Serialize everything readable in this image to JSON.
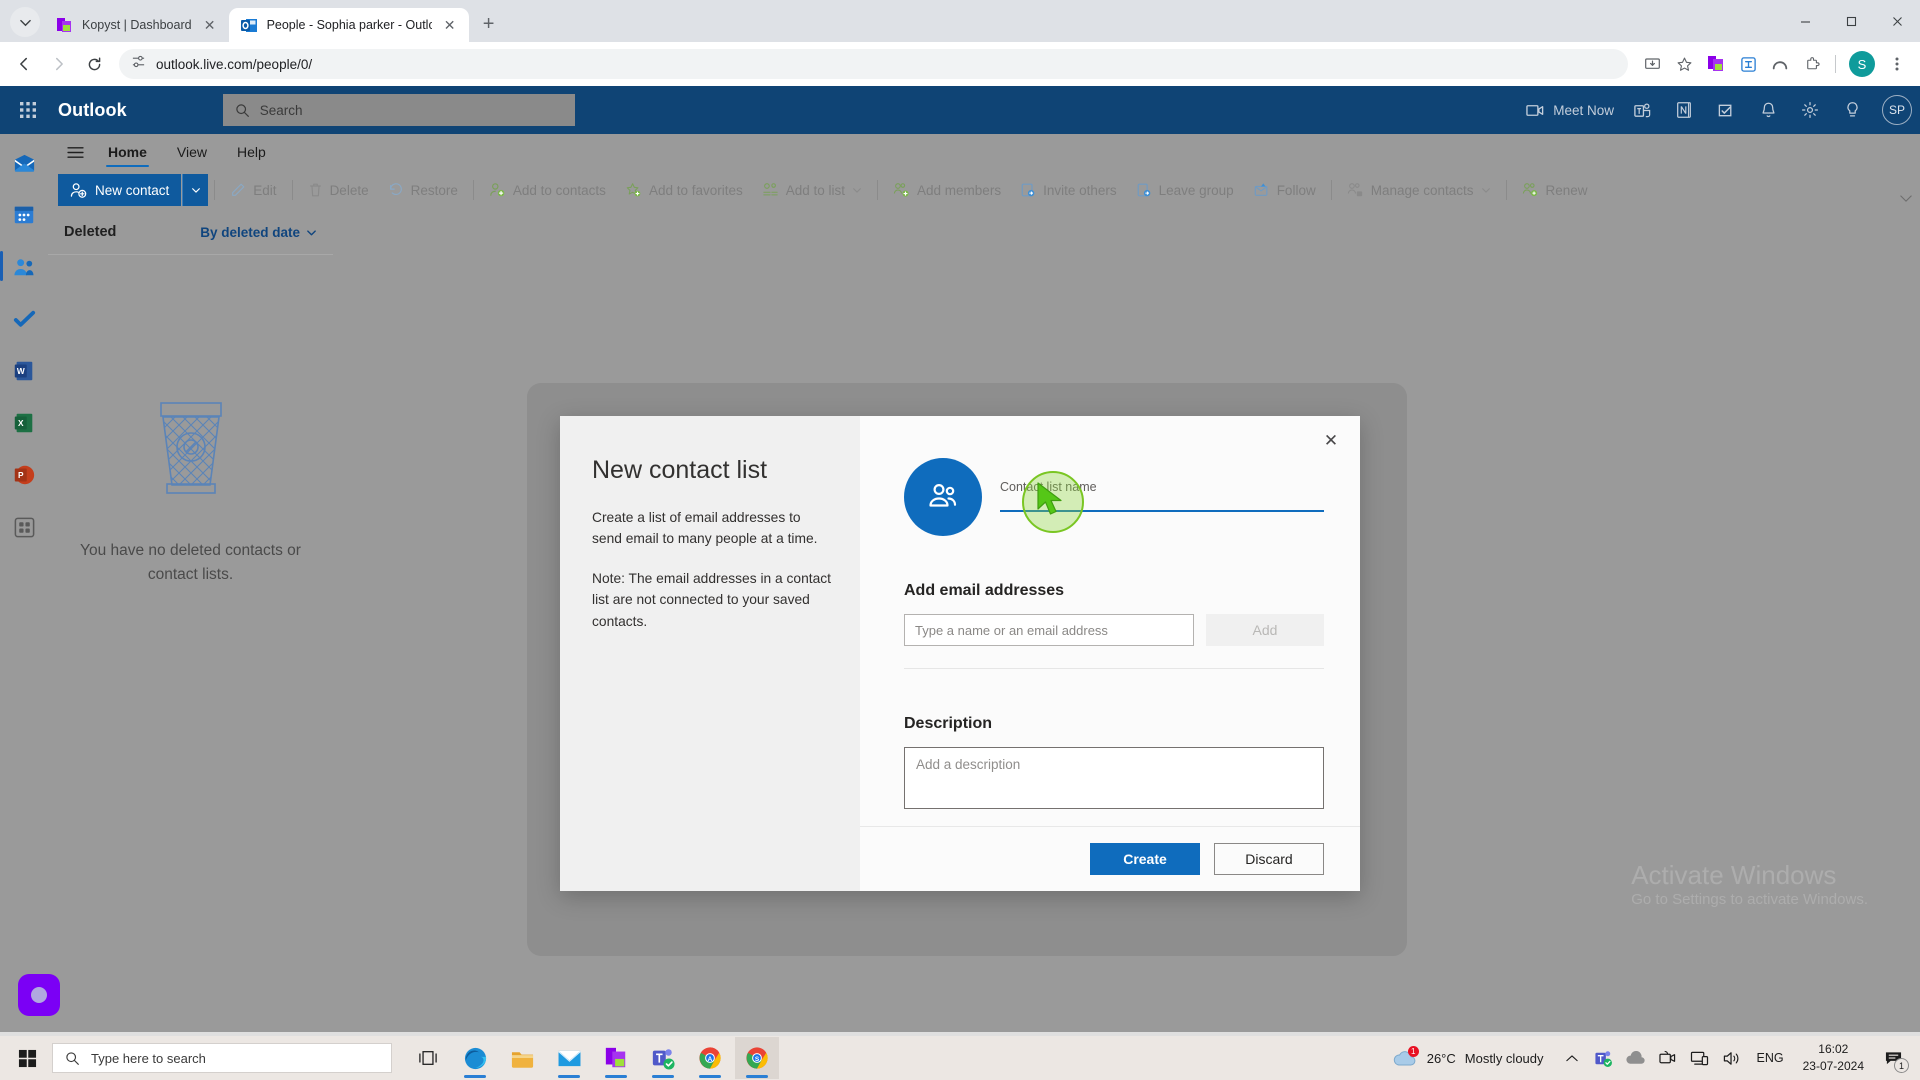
{
  "browser": {
    "tabs": [
      {
        "title": "Kopyst | Dashboard",
        "favicon": "kopyst-icon",
        "active": false
      },
      {
        "title": "People - Sophia parker - Outlook",
        "favicon": "outlook-icon",
        "active": true
      }
    ],
    "new_tab_label": "+",
    "close_glyph": "✕",
    "url": "outlook.live.com/people/0/",
    "nav": {
      "back": "←",
      "forward": "→",
      "reload": "⟳"
    },
    "profile_initial": "S",
    "window_controls": {
      "minimize": "–",
      "maximize": "□",
      "close": "✕"
    }
  },
  "outlook": {
    "brand": "Outlook",
    "search_placeholder": "Search",
    "meet_now_label": "Meet Now",
    "header_icons": [
      "meet-now-icon",
      "teams-icon",
      "onenote-icon",
      "todo-icon",
      "bell-icon",
      "gear-icon",
      "lightbulb-icon"
    ],
    "avatar_initials": "SP",
    "rail_items": [
      {
        "name": "mail",
        "selected": false
      },
      {
        "name": "calendar",
        "selected": false
      },
      {
        "name": "people",
        "selected": true
      },
      {
        "name": "todo",
        "selected": false
      },
      {
        "name": "word",
        "selected": false
      },
      {
        "name": "excel",
        "selected": false
      },
      {
        "name": "powerpoint",
        "selected": false
      },
      {
        "name": "all-apps",
        "selected": false
      }
    ],
    "ribbon_tabs": [
      {
        "label": "Home",
        "selected": true
      },
      {
        "label": "View",
        "selected": false
      },
      {
        "label": "Help",
        "selected": false
      }
    ],
    "ribbon": {
      "new_contact": "New contact",
      "buttons": [
        {
          "label": "Edit",
          "icon": "pencil-icon",
          "disabled": true
        },
        {
          "label": "Delete",
          "icon": "trash-icon",
          "disabled": true
        },
        {
          "label": "Restore",
          "icon": "restore-icon",
          "disabled": true
        },
        {
          "label": "Add to contacts",
          "icon": "add-contact-icon",
          "disabled": true
        },
        {
          "label": "Add to favorites",
          "icon": "star-icon",
          "disabled": true
        },
        {
          "label": "Add to list",
          "icon": "list-icon",
          "disabled": true,
          "caret": true
        },
        {
          "label": "Add members",
          "icon": "add-members-icon",
          "disabled": true
        },
        {
          "label": "Invite others",
          "icon": "invite-icon",
          "disabled": true
        },
        {
          "label": "Leave group",
          "icon": "leave-group-icon",
          "disabled": true
        },
        {
          "label": "Follow",
          "icon": "follow-icon",
          "disabled": true
        },
        {
          "label": "Manage contacts",
          "icon": "manage-contacts-icon",
          "disabled": true,
          "caret": true
        },
        {
          "label": "Renew",
          "icon": "renew-icon",
          "disabled": true
        }
      ]
    },
    "list_pane": {
      "title": "Deleted",
      "sort_label": "By deleted date",
      "empty_line1": "You have no deleted contacts or",
      "empty_line2": "contact lists."
    }
  },
  "modal": {
    "title": "New contact list",
    "paragraph1": "Create a list of email addresses to send email to many people at a time.",
    "paragraph2": "Note: The email addresses in a contact list are not connected to your saved contacts.",
    "close_glyph": "✕",
    "name_label": "Contact list name",
    "name_value": "",
    "email_section_title": "Add email addresses",
    "email_placeholder": "Type a name or an email address",
    "email_value": "",
    "add_button": "Add",
    "description_title": "Description",
    "description_placeholder": "Add a description",
    "description_value": "",
    "create_button": "Create",
    "discard_button": "Discard",
    "accent_color": "#0f6cbd"
  },
  "windows": {
    "watermark_line1": "Activate Windows",
    "watermark_line2": "Go to Settings to activate Windows.",
    "taskbar": {
      "search_placeholder": "Type here to search",
      "apps": [
        "task-view-icon",
        "edge-icon",
        "file-explorer-icon",
        "mail-icon",
        "kopyst-icon",
        "teams-icon",
        "chrome-a-icon",
        "chrome-s-icon"
      ],
      "temperature": "26°C",
      "weather_text": "Mostly cloudy",
      "language": "ENG",
      "time": "16:02",
      "date": "23-07-2024",
      "notification_count": "1"
    }
  }
}
